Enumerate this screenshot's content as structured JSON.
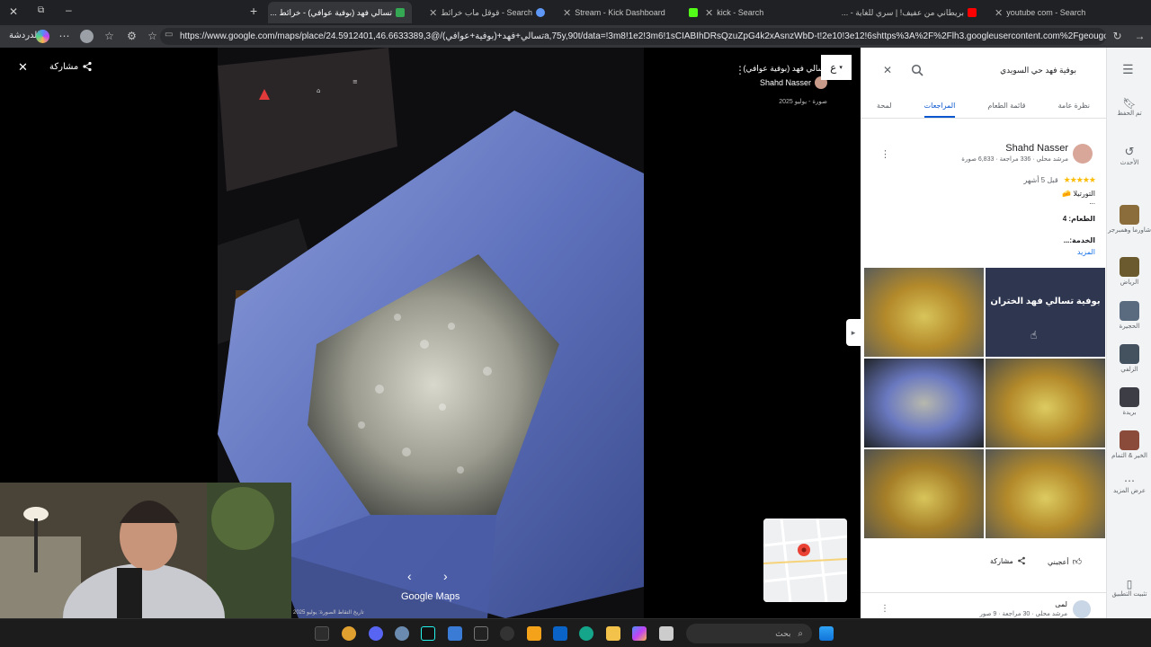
{
  "tabs": [
    {
      "title": "تسالي فهد (بوفية عوافي) - خرائط ...",
      "active": true
    },
    {
      "title": "Search - قوقل ماب خرائط"
    },
    {
      "title": "Stream - Kick Dashboard"
    },
    {
      "title": "kick - Search"
    },
    {
      "title": "بريطاني من عفيف! | سري للغاية - ..."
    },
    {
      "title": "youtube com - Search"
    }
  ],
  "browser": {
    "url": "https://www.google.com/maps/place/تسالي+فهد+(بوفية+عوافي)/@24.5912401,46.6633389,3a,75y,90t/data=!3m8!1e2!3m6!1sCIABIhDRsQzuZpG4k2xAsnzWbD-t!2e10!3e12!6shttps%3A%2F%2Flh3.googleusercontent.com%2Fgeougc-c...",
    "profile_label": "الدردشة"
  },
  "viewer": {
    "close_label": "✕",
    "share_label": "مشاركة",
    "place_name": "تسالي فهد (بوفية عوافي)",
    "author": "Shahd Nasser",
    "date": "صورة - يوليو 2025",
    "badge": "ع",
    "brand": "Google Maps",
    "capture_date": "تاريخ التقاط الصورة: يوليو 2025"
  },
  "sidebar": {
    "search_value": "بوفية فهد حي السويدي",
    "tabs": [
      "نظرة عامة",
      "قائمة الطعام",
      "المراجعات",
      "لمحة"
    ],
    "active_tab": 2,
    "review": {
      "name": "Shahd Nasser",
      "meta": "مرشد محلي · 336 مراجعة · 6,833 صورة",
      "time": "قبل 5 أشهر",
      "rating": 5,
      "text1": "التورتيلا 🧀",
      "text2": "...",
      "food": "الطعام: 4",
      "service": "الخدمة:...",
      "more": "المزيد",
      "like": "أعجبني",
      "share": "مشاركة",
      "next_name": "لمى",
      "next_meta": "مرشد محلي · 30 مراجعة · 9 صور"
    },
    "sign_text": "بوفية تسالي فهد الختران"
  },
  "rail": [
    {
      "label": "تم الحفظ",
      "icon": "bookmark-icon"
    },
    {
      "label": "الأحدث",
      "icon": "history-icon"
    },
    {
      "label": "شاورما وهمبرجر",
      "thumb": "#8a6d3b"
    },
    {
      "label": "الرياض",
      "thumb": "#6b5a2e"
    },
    {
      "label": "الحجيرة",
      "thumb": "#5a6b80"
    },
    {
      "label": "الزلفي",
      "thumb": "#44515f"
    },
    {
      "label": "بريدة",
      "thumb": "#3d3d46"
    },
    {
      "label": "الخير & التمام",
      "thumb": "#8a4b3a"
    },
    {
      "label": "عرض المزيد",
      "icon": "more-icon"
    },
    {
      "label": "تثبيت التطبيق",
      "icon": "install-icon"
    }
  ],
  "taskbar": {
    "search_placeholder": "بحث"
  },
  "colors": {
    "accent": "#1a73e8",
    "review_star": "#fbbc04",
    "maps_blue": "#0b57d0"
  }
}
